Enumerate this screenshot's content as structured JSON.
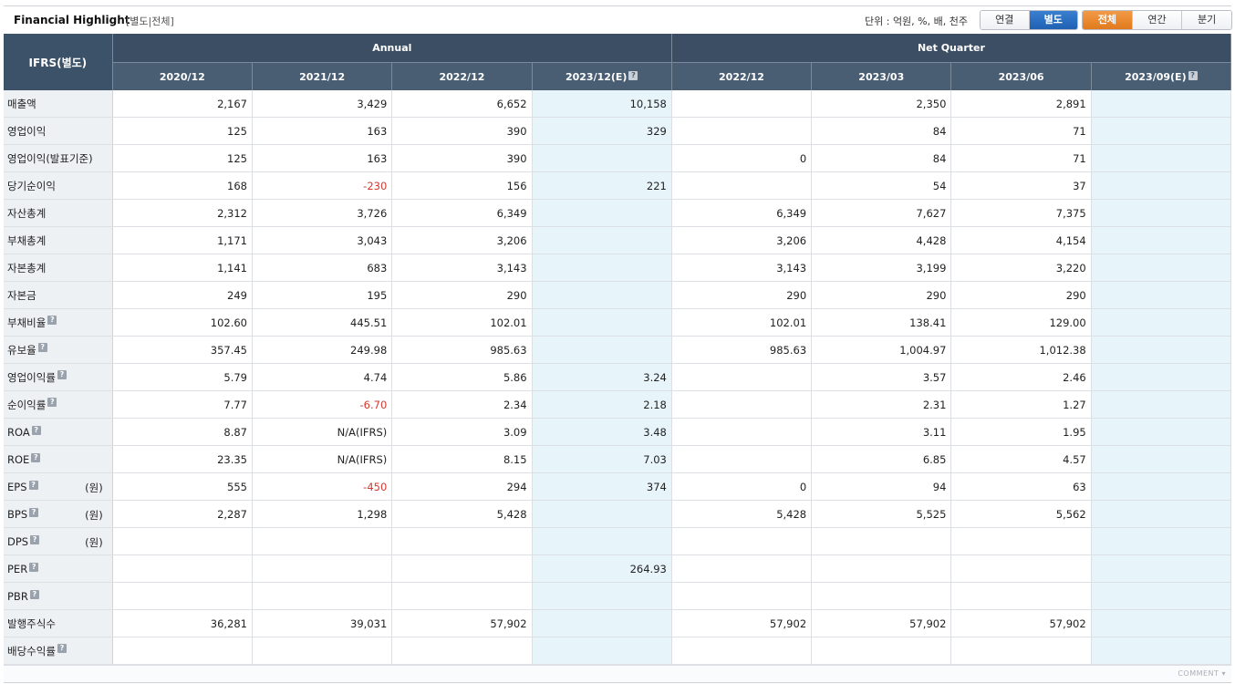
{
  "header": {
    "title": "Financial Highlight",
    "subtitle": "[별도|전체]",
    "unit": "단위 : 억원, %, 배, 천주",
    "consolidation_buttons": [
      "연결",
      "별도"
    ],
    "period_buttons": [
      "전체",
      "연간",
      "분기"
    ],
    "active_consolidation": "별도",
    "active_period": "전체"
  },
  "table": {
    "corner": "IFRS(별도)",
    "groups": {
      "annual": "Annual",
      "quarter": "Net Quarter"
    },
    "columns": [
      "2020/12",
      "2021/12",
      "2022/12",
      "2023/12(E)",
      "2022/12",
      "2023/03",
      "2023/06",
      "2023/09(E)"
    ],
    "rows": [
      {
        "label": "매출액",
        "help": false,
        "unit": "",
        "values": [
          "2,167",
          "3,429",
          "6,652",
          "10,158",
          "",
          "2,350",
          "2,891",
          ""
        ]
      },
      {
        "label": "영업이익",
        "help": false,
        "unit": "",
        "values": [
          "125",
          "163",
          "390",
          "329",
          "",
          "84",
          "71",
          ""
        ]
      },
      {
        "label": "영업이익(발표기준)",
        "help": false,
        "unit": "",
        "values": [
          "125",
          "163",
          "390",
          "",
          "0",
          "84",
          "71",
          ""
        ]
      },
      {
        "label": "당기순이익",
        "help": false,
        "unit": "",
        "values": [
          "168",
          "-230",
          "156",
          "221",
          "",
          "54",
          "37",
          ""
        ]
      },
      {
        "label": "자산총계",
        "help": false,
        "unit": "",
        "values": [
          "2,312",
          "3,726",
          "6,349",
          "",
          "6,349",
          "7,627",
          "7,375",
          ""
        ]
      },
      {
        "label": "부채총계",
        "help": false,
        "unit": "",
        "values": [
          "1,171",
          "3,043",
          "3,206",
          "",
          "3,206",
          "4,428",
          "4,154",
          ""
        ]
      },
      {
        "label": "자본총계",
        "help": false,
        "unit": "",
        "values": [
          "1,141",
          "683",
          "3,143",
          "",
          "3,143",
          "3,199",
          "3,220",
          ""
        ]
      },
      {
        "label": "자본금",
        "help": false,
        "unit": "",
        "values": [
          "249",
          "195",
          "290",
          "",
          "290",
          "290",
          "290",
          ""
        ]
      },
      {
        "label": "부채비율",
        "help": true,
        "unit": "",
        "values": [
          "102.60",
          "445.51",
          "102.01",
          "",
          "102.01",
          "138.41",
          "129.00",
          ""
        ]
      },
      {
        "label": "유보율",
        "help": true,
        "unit": "",
        "values": [
          "357.45",
          "249.98",
          "985.63",
          "",
          "985.63",
          "1,004.97",
          "1,012.38",
          ""
        ]
      },
      {
        "label": "영업이익률",
        "help": true,
        "unit": "",
        "values": [
          "5.79",
          "4.74",
          "5.86",
          "3.24",
          "",
          "3.57",
          "2.46",
          ""
        ]
      },
      {
        "label": "순이익률",
        "help": true,
        "unit": "",
        "values": [
          "7.77",
          "-6.70",
          "2.34",
          "2.18",
          "",
          "2.31",
          "1.27",
          ""
        ]
      },
      {
        "label": "ROA",
        "help": true,
        "unit": "",
        "values": [
          "8.87",
          "N/A(IFRS)",
          "3.09",
          "3.48",
          "",
          "3.11",
          "1.95",
          ""
        ]
      },
      {
        "label": "ROE",
        "help": true,
        "unit": "",
        "values": [
          "23.35",
          "N/A(IFRS)",
          "8.15",
          "7.03",
          "",
          "6.85",
          "4.57",
          ""
        ]
      },
      {
        "label": "EPS",
        "help": true,
        "unit": "(원)",
        "values": [
          "555",
          "-450",
          "294",
          "374",
          "0",
          "94",
          "63",
          ""
        ]
      },
      {
        "label": "BPS",
        "help": true,
        "unit": "(원)",
        "values": [
          "2,287",
          "1,298",
          "5,428",
          "",
          "5,428",
          "5,525",
          "5,562",
          ""
        ]
      },
      {
        "label": "DPS",
        "help": true,
        "unit": "(원)",
        "values": [
          "",
          "",
          "",
          "",
          "",
          "",
          "",
          ""
        ]
      },
      {
        "label": "PER",
        "help": true,
        "unit": "",
        "values": [
          "",
          "",
          "",
          "264.93",
          "",
          "",
          "",
          ""
        ]
      },
      {
        "label": "PBR",
        "help": true,
        "unit": "",
        "values": [
          "",
          "",
          "",
          "",
          "",
          "",
          "",
          ""
        ]
      },
      {
        "label": "발행주식수",
        "help": false,
        "unit": "",
        "values": [
          "36,281",
          "39,031",
          "57,902",
          "",
          "57,902",
          "57,902",
          "57,902",
          ""
        ]
      },
      {
        "label": "배당수익률",
        "help": true,
        "unit": "",
        "values": [
          "",
          "",
          "",
          "",
          "",
          "",
          "",
          ""
        ]
      }
    ]
  },
  "footer": {
    "comment": "COMMENT"
  },
  "colors": {
    "header_dark": "#3b4e63",
    "header_col": "#4a5e73",
    "estimate_bg": "#e7f4fa",
    "negative": "#d6382f",
    "active_blue": "#1f61b3",
    "active_orange": "#e17a1d"
  }
}
